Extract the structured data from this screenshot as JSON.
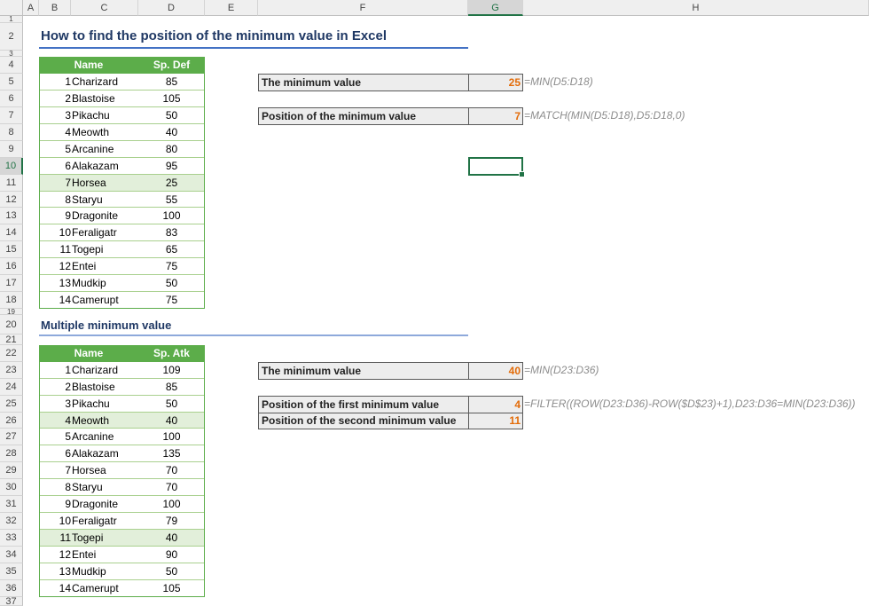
{
  "columns": [
    "A",
    "B",
    "C",
    "D",
    "E",
    "F",
    "G",
    "H"
  ],
  "selected_column": "G",
  "rows": [
    "1",
    "2",
    "3",
    "4",
    "5",
    "6",
    "7",
    "8",
    "9",
    "10",
    "11",
    "12",
    "13",
    "14",
    "15",
    "16",
    "17",
    "18",
    "19",
    "20",
    "21",
    "22",
    "23",
    "24",
    "25",
    "26",
    "27",
    "28",
    "29",
    "30",
    "31",
    "32",
    "33",
    "34",
    "35",
    "36",
    "37"
  ],
  "selected_row": "10",
  "section1": {
    "title": "How to find the position of the minimum value in Excel",
    "accent_color": "#4472c4",
    "header": [
      "Name",
      "Sp. Def"
    ],
    "rows": [
      {
        "n": "1",
        "name": "Charizard",
        "val": "85"
      },
      {
        "n": "2",
        "name": "Blastoise",
        "val": "105"
      },
      {
        "n": "3",
        "name": "Pikachu",
        "val": "50"
      },
      {
        "n": "4",
        "name": "Meowth",
        "val": "40"
      },
      {
        "n": "5",
        "name": "Arcanine",
        "val": "80"
      },
      {
        "n": "6",
        "name": "Alakazam",
        "val": "95"
      },
      {
        "n": "7",
        "name": "Horsea",
        "val": "25"
      },
      {
        "n": "8",
        "name": "Staryu",
        "val": "55"
      },
      {
        "n": "9",
        "name": "Dragonite",
        "val": "100"
      },
      {
        "n": "10",
        "name": "Feraligatr",
        "val": "83"
      },
      {
        "n": "11",
        "name": "Togepi",
        "val": "65"
      },
      {
        "n": "12",
        "name": "Entei",
        "val": "75"
      },
      {
        "n": "13",
        "name": "Mudkip",
        "val": "50"
      },
      {
        "n": "14",
        "name": "Camerupt",
        "val": "75"
      }
    ],
    "min_label": "The minimum value",
    "min_value": "25",
    "min_formula": "=MIN(D5:D18)",
    "pos_label": "Position of the minimum value",
    "pos_value": "7",
    "pos_formula": "=MATCH(MIN(D5:D18),D5:D18,0)"
  },
  "section2": {
    "title": "Multiple minimum value",
    "accent_color": "#8ea9db",
    "header": [
      "Name",
      "Sp. Atk"
    ],
    "rows": [
      {
        "n": "1",
        "name": "Charizard",
        "val": "109"
      },
      {
        "n": "2",
        "name": "Blastoise",
        "val": "85"
      },
      {
        "n": "3",
        "name": "Pikachu",
        "val": "50"
      },
      {
        "n": "4",
        "name": "Meowth",
        "val": "40"
      },
      {
        "n": "5",
        "name": "Arcanine",
        "val": "100"
      },
      {
        "n": "6",
        "name": "Alakazam",
        "val": "135"
      },
      {
        "n": "7",
        "name": "Horsea",
        "val": "70"
      },
      {
        "n": "8",
        "name": "Staryu",
        "val": "70"
      },
      {
        "n": "9",
        "name": "Dragonite",
        "val": "100"
      },
      {
        "n": "10",
        "name": "Feraligatr",
        "val": "79"
      },
      {
        "n": "11",
        "name": "Togepi",
        "val": "40"
      },
      {
        "n": "12",
        "name": "Entei",
        "val": "90"
      },
      {
        "n": "13",
        "name": "Mudkip",
        "val": "50"
      },
      {
        "n": "14",
        "name": "Camerupt",
        "val": "105"
      }
    ],
    "min_label": "The minimum value",
    "min_value": "40",
    "min_formula": "=MIN(D23:D36)",
    "first_label": "Position of the first minimum value",
    "first_value": "4",
    "filter_formula": "=FILTER((ROW(D23:D36)-ROW($D$23)+1),D23:D36=MIN(D23:D36))",
    "second_label": "Position of the second minimum value",
    "second_value": "11"
  },
  "colors": {
    "table_header": "#5cad4a",
    "highlight_row": "#e2efda",
    "result_text": "#e36c09",
    "selection": "#217346"
  }
}
